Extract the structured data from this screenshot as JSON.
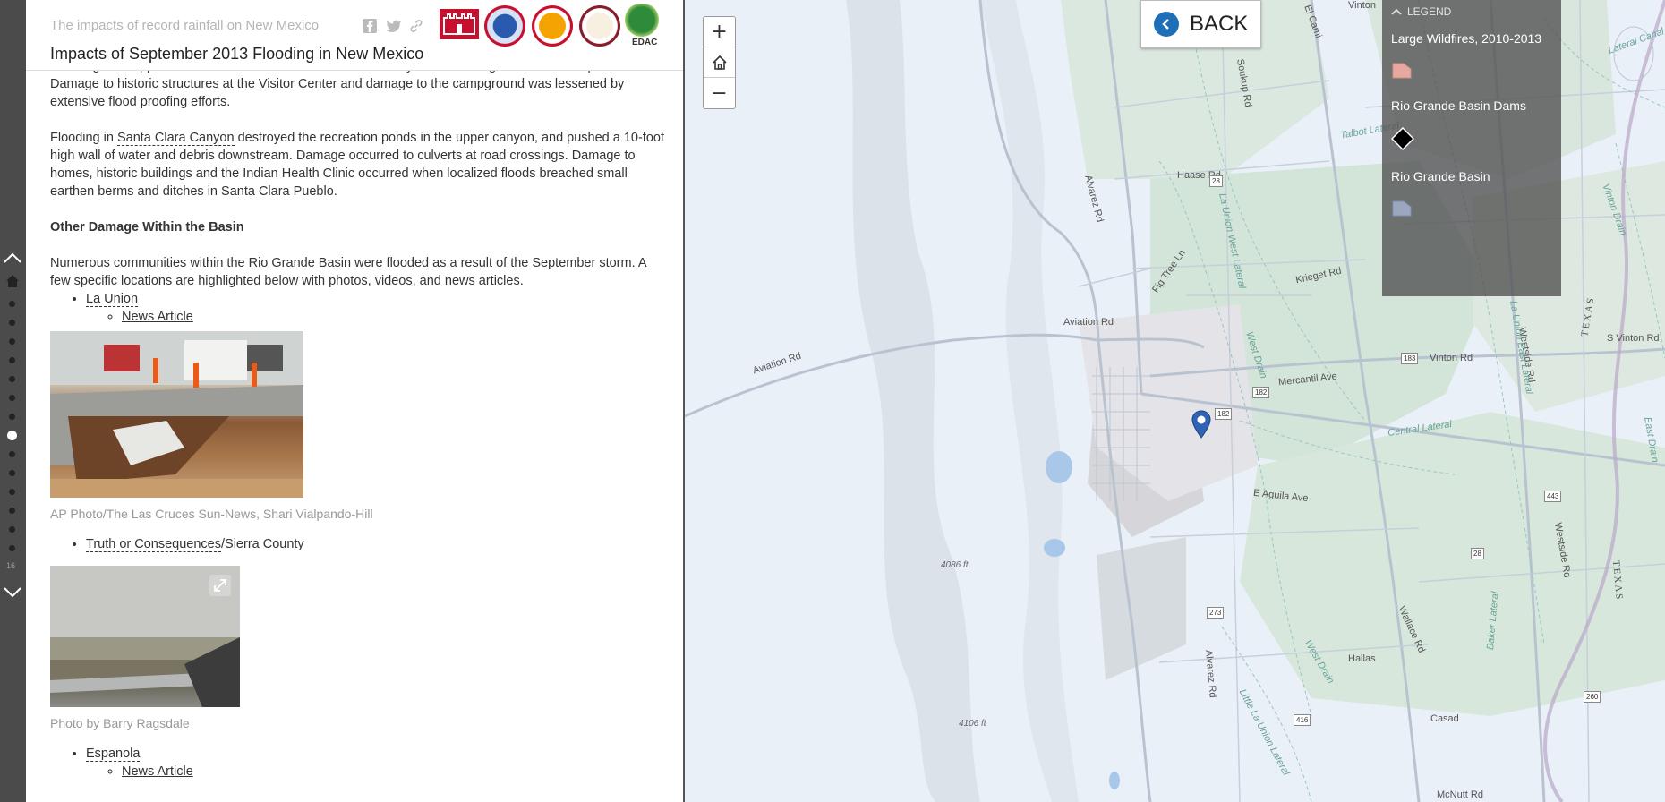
{
  "header": {
    "subtitle": "The impacts of record rainfall on New Mexico",
    "title": "Impacts of September 2013 Flooding in New Mexico",
    "logo_edac_text": "EDAC"
  },
  "nav": {
    "current_slide": "16",
    "dot_count": 14,
    "active_index": 7
  },
  "story": {
    "para1": "Flooding overtopped access roads and trails in the Lower Canyon and damaged some developed roads. Damage to historic structures at the Visitor Center and damage to the campground was lessened by extensive flood proofing efforts.",
    "para2_pre": "Flooding in ",
    "para2_link": "Santa Clara Canyon",
    "para2_post": " destroyed the recreation ponds in the upper canyon, and pushed a 10-foot high wall of water and debris downstream. Damage occurred to culverts at road crossings. Damage to homes, historic buildings and the Indian Health Clinic occurred when localized floods breached small earthen berms and ditches in Santa Clara Pueblo.",
    "heading": "Other Damage Within the Basin",
    "para3": "Numerous communities within the Rio Grande Basin were flooded as a result of the September storm. A few specific locations are highlighted below with photos, videos, and news articles.",
    "loc1_name": "La Union",
    "loc1_news": "News Article",
    "photo1_caption": "AP Photo/The Las Cruces Sun-News, Shari Vialpando-Hill",
    "loc2_name": "Truth or Consequences",
    "loc2_suffix": "/Sierra County",
    "photo2_caption": "Photo by Barry Ragsdale",
    "loc3_name": "Espanola",
    "loc3_news": "News Article"
  },
  "map": {
    "zoom_in": "+",
    "zoom_out": "−",
    "back_label": "BACK",
    "legend": {
      "title": "LEGEND",
      "items": [
        {
          "label": "Large Wildfires, 2010-2013",
          "color": "#e8a8a0"
        },
        {
          "label": "Rio Grande Basin Dams",
          "color": "#000000"
        },
        {
          "label": "Rio Grande Basin",
          "color": "#7d8fb0"
        }
      ]
    },
    "road_labels": {
      "aviation_w": "Aviation Rd",
      "aviation_e": "Aviation Rd",
      "alvarez_n": "Alvarez Rd",
      "alvarez_s": "Alvarez Rd",
      "soukup": "Soukup Rd",
      "haase": "Haase Rd",
      "fig_tree": "Fig Tree Ln",
      "krieget": "Krieget Rd",
      "mercantil": "Mercantil Ave",
      "vinton": "Vinton Rd",
      "vinton_top": "Vinton",
      "s_vinton": "S Vinton Rd",
      "aguila": "E Aguila Ave",
      "westside_n": "Westside Rd",
      "westside_s": "Westside Rd",
      "wallace": "Wallace Rd",
      "hallas": "Hallas",
      "casad": "Casad",
      "mcnutt": "McNutt Rd",
      "el_camino": "El Cami",
      "texas_n": "TEXAS",
      "texas_s": "TEXAS"
    },
    "water_labels": {
      "talbot": "Talbot Lateral",
      "la_union_west": "La Union West Lateral",
      "west_drain_n": "West Drain",
      "central": "Central Lateral",
      "west_drain_s": "West Drain",
      "little_la_union": "Little La Union Lateral",
      "baker": "Baker Lateral",
      "la_union_east": "La Union East Lateral",
      "vinton_drain": "Vinton Drain",
      "lateral_canal": "Lateral Canal",
      "east_drain": "East Drain"
    },
    "shields": {
      "s28a": "28",
      "s182a": "182",
      "s182b": "182",
      "s183": "183",
      "s443": "443",
      "s28b": "28",
      "s273": "273",
      "s416": "416",
      "s260": "260"
    },
    "elevations": {
      "e4086": "4086 ft",
      "e4106": "4106 ft"
    }
  }
}
